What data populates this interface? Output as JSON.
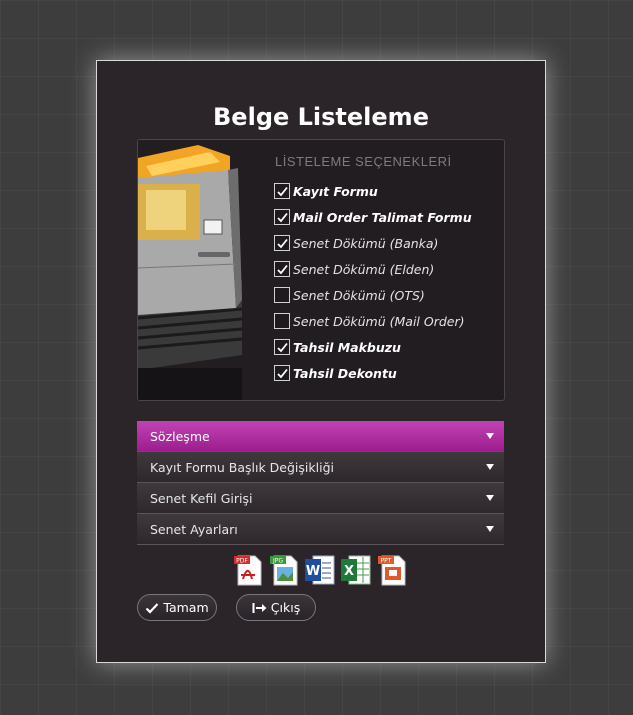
{
  "dialog": {
    "title": "Belge Listeleme",
    "options_header": "LİSTELEME SEÇENEKLERİ",
    "options": [
      {
        "label": "Kayıt Formu",
        "checked": true,
        "bold": true
      },
      {
        "label": "Mail Order Talimat Formu",
        "checked": true,
        "bold": true
      },
      {
        "label": "Senet Dökümü (Banka)",
        "checked": true,
        "bold": false
      },
      {
        "label": "Senet Dökümü (Elden)",
        "checked": true,
        "bold": false
      },
      {
        "label": "Senet Dökümü (OTS)",
        "checked": false,
        "bold": false
      },
      {
        "label": "Senet Dökümü (Mail Order)",
        "checked": false,
        "bold": false
      },
      {
        "label": "Tahsil Makbuzu",
        "checked": true,
        "bold": true
      },
      {
        "label": "Tahsil Dekontu",
        "checked": true,
        "bold": true
      }
    ],
    "accordion": [
      {
        "label": "Sözleşme",
        "active": true
      },
      {
        "label": "Kayıt Formu Başlık Değişikliği",
        "active": false
      },
      {
        "label": "Senet Kefil Girişi",
        "active": false
      },
      {
        "label": "Senet Ayarları",
        "active": false
      }
    ],
    "exports": [
      {
        "icon": "pdf-icon",
        "tag": "PDF"
      },
      {
        "icon": "jpg-icon",
        "tag": "JPG"
      },
      {
        "icon": "word-icon",
        "tag": "W"
      },
      {
        "icon": "excel-icon",
        "tag": "X"
      },
      {
        "icon": "ppt-icon",
        "tag": "PPT"
      }
    ],
    "buttons": {
      "ok_label": "Tamam",
      "exit_label": "Çıkış"
    }
  },
  "colors": {
    "accent": "#b0309f",
    "background": "#3d3d3d",
    "dialog_bg": "#2b2529"
  }
}
